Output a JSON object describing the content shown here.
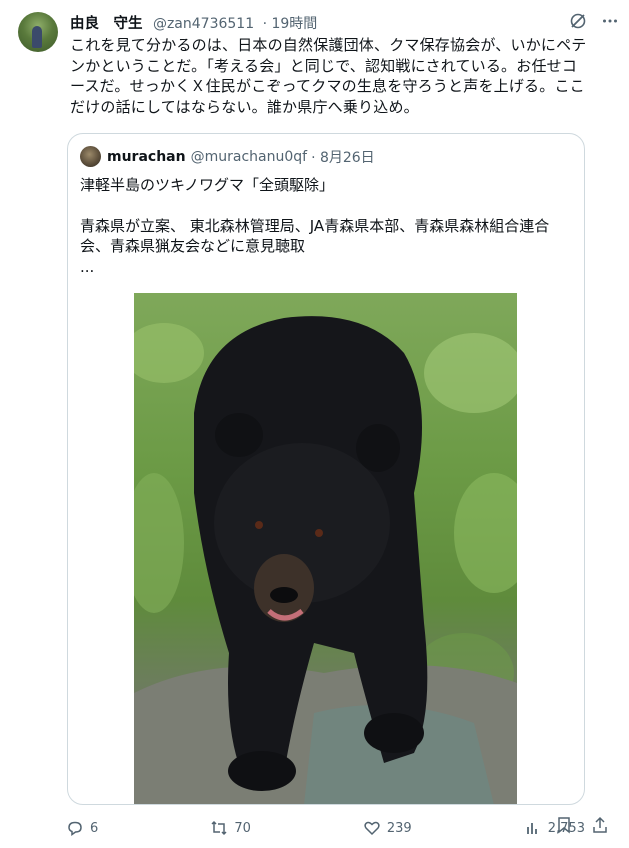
{
  "tweet": {
    "author_name": "由良　守生",
    "author_handle": "@zan4736511",
    "time": "· 19時間",
    "text": "これを見て分かるのは、日本の自然保護団体、クマ保存協会が、いかにペテンかということだ。「考える会」と同じで、認知戦にされている。お任せコースだ。せっかくＸ住民がこぞってクマの生息を守ろうと声を上げる。ここだけの話にしてはならない。誰か県庁へ乗り込め。"
  },
  "quote": {
    "author_name": "murachan",
    "author_handle": "@murachanu0qf",
    "time": "· 8月26日",
    "line1": "津軽半島のツキノワグマ「全頭駆除」",
    "line2": "青森県が立案、 東北森林管理局、JA青森県本部、青森県森林組合連合会、青森県猟友会などに意見聴取",
    "line3": "..."
  },
  "actions": {
    "replies": "6",
    "reposts": "70",
    "likes": "239",
    "views": "2,753"
  },
  "icons": [
    "grok-icon",
    "more-icon",
    "reply-icon",
    "repost-icon",
    "like-icon",
    "views-icon",
    "bookmark-icon",
    "share-icon"
  ]
}
